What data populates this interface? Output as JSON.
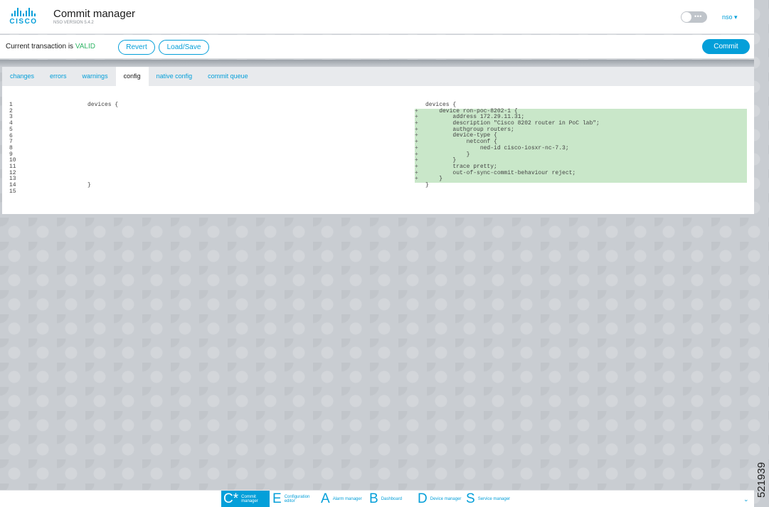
{
  "header": {
    "logo_text": "CISCO",
    "title": "Commit manager",
    "version": "NSO VERSION 5.4.2",
    "toggle_dots": "•••",
    "user": "nso ▾"
  },
  "action_bar": {
    "status_prefix": "Current transaction is ",
    "status_value": "VALID",
    "revert_label": "Revert",
    "load_save_label": "Load/Save",
    "commit_label": "Commit"
  },
  "tabs": [
    "changes",
    "errors",
    "warnings",
    "config",
    "native config",
    "commit queue"
  ],
  "active_tab": "config",
  "diff": {
    "line_numbers": "1\n2\n3\n4\n5\n6\n7\n8\n9\n10\n11\n12\n13\n14\n15",
    "left": "devices {\n\n\n\n\n\n\n\n\n\n\n\n\n}",
    "right": [
      {
        "marker": "",
        "text": "devices {",
        "added": false
      },
      {
        "marker": "+",
        "text": "    device ron-poc-8202-1 {",
        "added": true
      },
      {
        "marker": "+",
        "text": "        address 172.29.11.31;",
        "added": true
      },
      {
        "marker": "+",
        "text": "        description \"Cisco 8202 router in PoC lab\";",
        "added": true
      },
      {
        "marker": "+",
        "text": "        authgroup routers;",
        "added": true
      },
      {
        "marker": "+",
        "text": "        device-type {",
        "added": true
      },
      {
        "marker": "+",
        "text": "            netconf {",
        "added": true
      },
      {
        "marker": "+",
        "text": "                ned-id cisco-iosxr-nc-7.3;",
        "added": true
      },
      {
        "marker": "+",
        "text": "            }",
        "added": true
      },
      {
        "marker": "+",
        "text": "        }",
        "added": true
      },
      {
        "marker": "+",
        "text": "        trace pretty;",
        "added": true
      },
      {
        "marker": "+",
        "text": "        out-of-sync-commit-behaviour reject;",
        "added": true
      },
      {
        "marker": "+",
        "text": "    }",
        "added": true
      },
      {
        "marker": "",
        "text": "}",
        "added": false
      }
    ]
  },
  "dock": [
    {
      "letter": "C*",
      "label": "Commit manager",
      "active": true
    },
    {
      "letter": "E",
      "label": "Configuration editor",
      "active": false
    },
    {
      "letter": "A",
      "label": "Alarm manager",
      "active": false
    },
    {
      "letter": "B",
      "label": "Dashboard",
      "active": false
    },
    {
      "letter": "D",
      "label": "Device manager",
      "active": false
    },
    {
      "letter": "S",
      "label": "Service manager",
      "active": false
    }
  ],
  "dock_chevron": "⌄",
  "figure_id": "521939",
  "colors": {
    "accent": "#049fd9",
    "valid": "#30b566",
    "added_bg": "#c9e7c9"
  }
}
